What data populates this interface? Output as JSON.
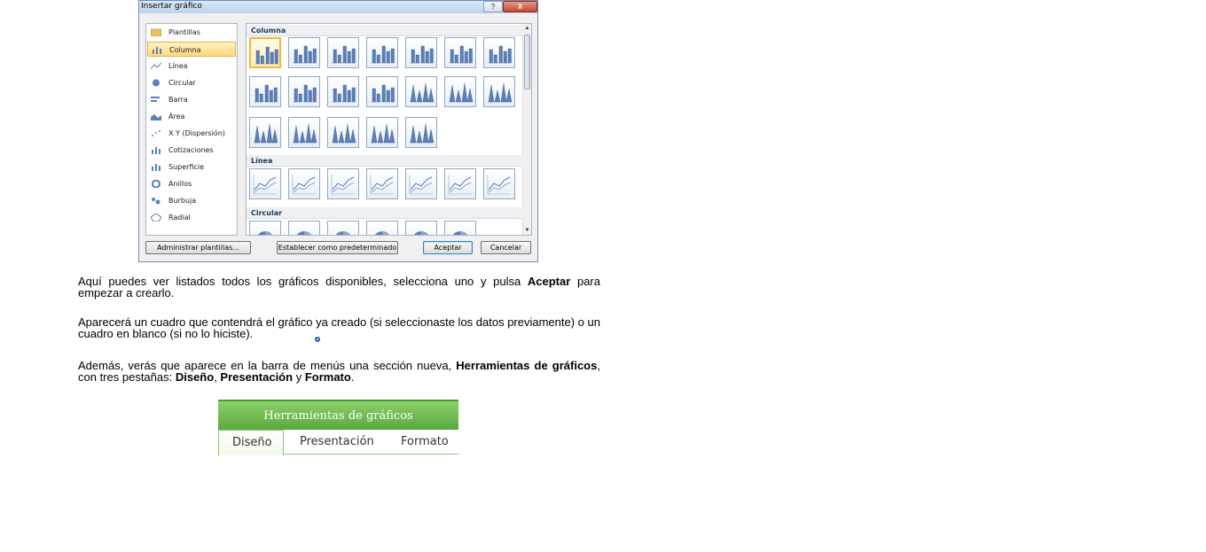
{
  "dialog": {
    "title": "Insertar gráfico",
    "help_label": "?",
    "close_label": "X",
    "categories": [
      {
        "label": "Plantillas",
        "icon": "folder-icon"
      },
      {
        "label": "Columna",
        "icon": "column-chart-icon",
        "selected": true
      },
      {
        "label": "Línea",
        "icon": "line-chart-icon"
      },
      {
        "label": "Circular",
        "icon": "pie-chart-icon"
      },
      {
        "label": "Barra",
        "icon": "bar-chart-icon"
      },
      {
        "label": "Área",
        "icon": "area-chart-icon"
      },
      {
        "label": "X Y (Dispersión)",
        "icon": "scatter-chart-icon"
      },
      {
        "label": "Cotizaciones",
        "icon": "stock-chart-icon"
      },
      {
        "label": "Superficie",
        "icon": "surface-chart-icon"
      },
      {
        "label": "Anillos",
        "icon": "doughnut-chart-icon"
      },
      {
        "label": "Burbuja",
        "icon": "bubble-chart-icon"
      },
      {
        "label": "Radial",
        "icon": "radar-chart-icon"
      }
    ],
    "gallery": {
      "sections": [
        {
          "label": "Columna"
        },
        {
          "label": "Línea"
        },
        {
          "label": "Circular"
        }
      ]
    },
    "buttons": {
      "manage_templates": "Administrar plantillas...",
      "set_default": "Establecer como predeterminado",
      "accept": "Aceptar",
      "cancel": "Cancelar"
    }
  },
  "text": {
    "p1_a": "Aquí puedes ver listados todos los gráficos disponibles, selecciona uno y pulsa ",
    "p1_b": "Aceptar",
    "p1_c": " para empezar a crearlo.",
    "p2": "Aparecerá un cuadro que contendrá el gráfico ya creado (si seleccionaste los datos previamente) o un cuadro en blanco (si no lo hiciste).",
    "p3_a": "Además, verás que aparece en la barra de menús una sección nueva, ",
    "p3_b": "Herramientas de gráficos",
    "p3_c": ", con tres pestañas: ",
    "p3_d": "Diseño",
    "p3_e": ", ",
    "p3_f": "Presentación",
    "p3_g": " y ",
    "p3_h": "Formato",
    "p3_i": "."
  },
  "ribbon": {
    "title": "Herramientas de gráficos",
    "tabs": [
      "Diseño",
      "Presentación",
      "Formato"
    ]
  },
  "colors": {
    "ribbon_green": "#5aa83e",
    "selection_gold": "#f1b838",
    "chart_blue": "#5b7fb8"
  }
}
